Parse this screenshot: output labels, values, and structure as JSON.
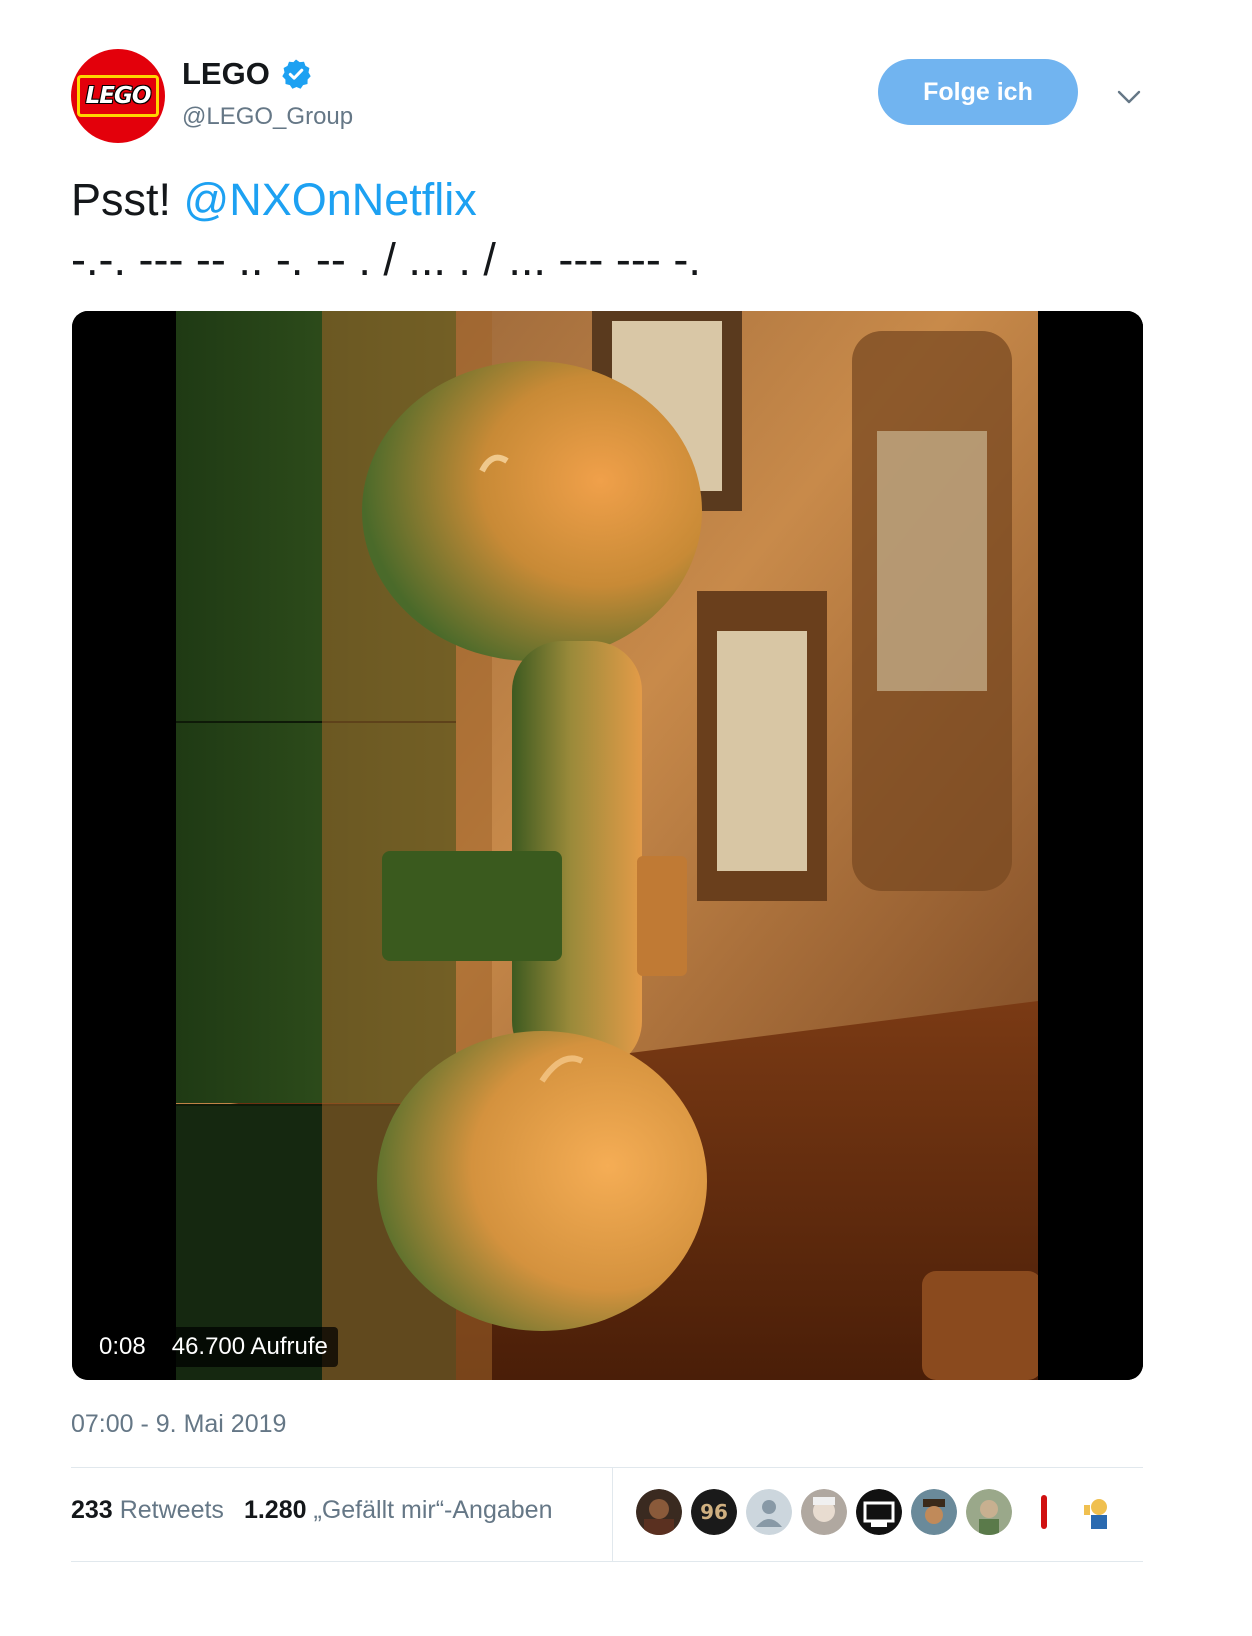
{
  "author": {
    "display_name": "LEGO",
    "handle": "@LEGO_Group",
    "avatar_logo_text": "LEGO",
    "verified": true
  },
  "follow_button": {
    "label": "Folge ich"
  },
  "tweet": {
    "text_prefix": "Psst! ",
    "mention": "@NXOnNetflix",
    "morse": "-.-. --- -- .. -. -- . / ... . / ... --- --- -."
  },
  "video": {
    "duration": "0:08",
    "views": "46.700 Aufrufe"
  },
  "timestamp": "07:00 - 9. Mai 2019",
  "stats": {
    "retweets_count": "233",
    "retweets_label": "Retweets",
    "likes_count": "1.280",
    "likes_label": "„Gefällt mir“-Angaben"
  },
  "likers": [
    {
      "name": "liker-1"
    },
    {
      "name": "liker-2"
    },
    {
      "name": "liker-3"
    },
    {
      "name": "liker-4"
    },
    {
      "name": "liker-5"
    },
    {
      "name": "liker-6"
    },
    {
      "name": "liker-7"
    },
    {
      "name": "liker-8"
    },
    {
      "name": "liker-9"
    }
  ],
  "colors": {
    "accent": "#1da1f2",
    "follow_button_bg": "#71b4f0",
    "secondary_text": "#657786",
    "lego_red": "#e3000b",
    "lego_yellow": "#ffd500"
  },
  "icons": {
    "verified": "verified-badge-icon",
    "more": "chevron-down-icon"
  }
}
